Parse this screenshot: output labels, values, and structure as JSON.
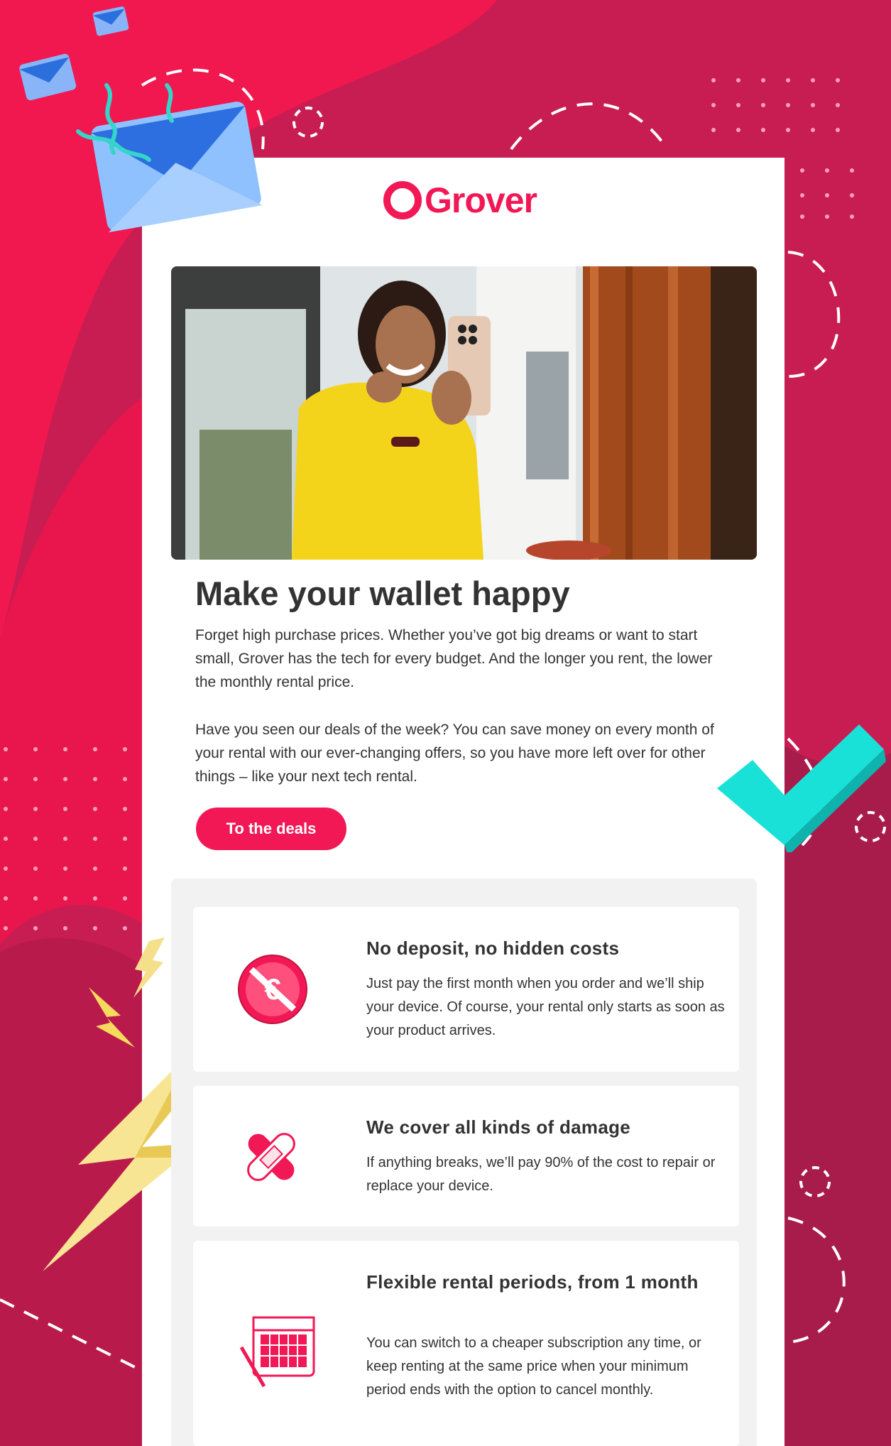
{
  "brand": {
    "name": "Grover",
    "accent": "#f21856"
  },
  "hero": {
    "alt": "Woman in yellow shirt holding a smartphone"
  },
  "content": {
    "title": "Make your wallet happy",
    "paragraph1": "Forget high purchase prices. Whether you’ve got big dreams or want to start small, Grover has the tech for every budget. And the longer you rent, the lower the monthly rental price.",
    "paragraph2": "Have you seen our deals of the week? You can save money on every month of your rental with our ever-changing offers, so you have more left over for other things – like your next tech rental.",
    "cta_label": "To the deals"
  },
  "features": [
    {
      "icon": "no-euro-icon",
      "title": "No deposit, no hidden costs",
      "desc": "Just pay the first month when you order and we’ll ship your device. Of course, your rental only starts as soon as your product arrives."
    },
    {
      "icon": "bandage-icon",
      "title": "We cover all kinds of damage",
      "desc": "If anything breaks, we’ll pay 90% of the cost to repair or replace your device."
    },
    {
      "icon": "calendar-icon",
      "title": "Flexible rental periods, from 1 month",
      "desc": "You can switch to a cheaper subscription any time, or keep renting at the same price when your minimum period ends with the option to cancel monthly."
    }
  ]
}
